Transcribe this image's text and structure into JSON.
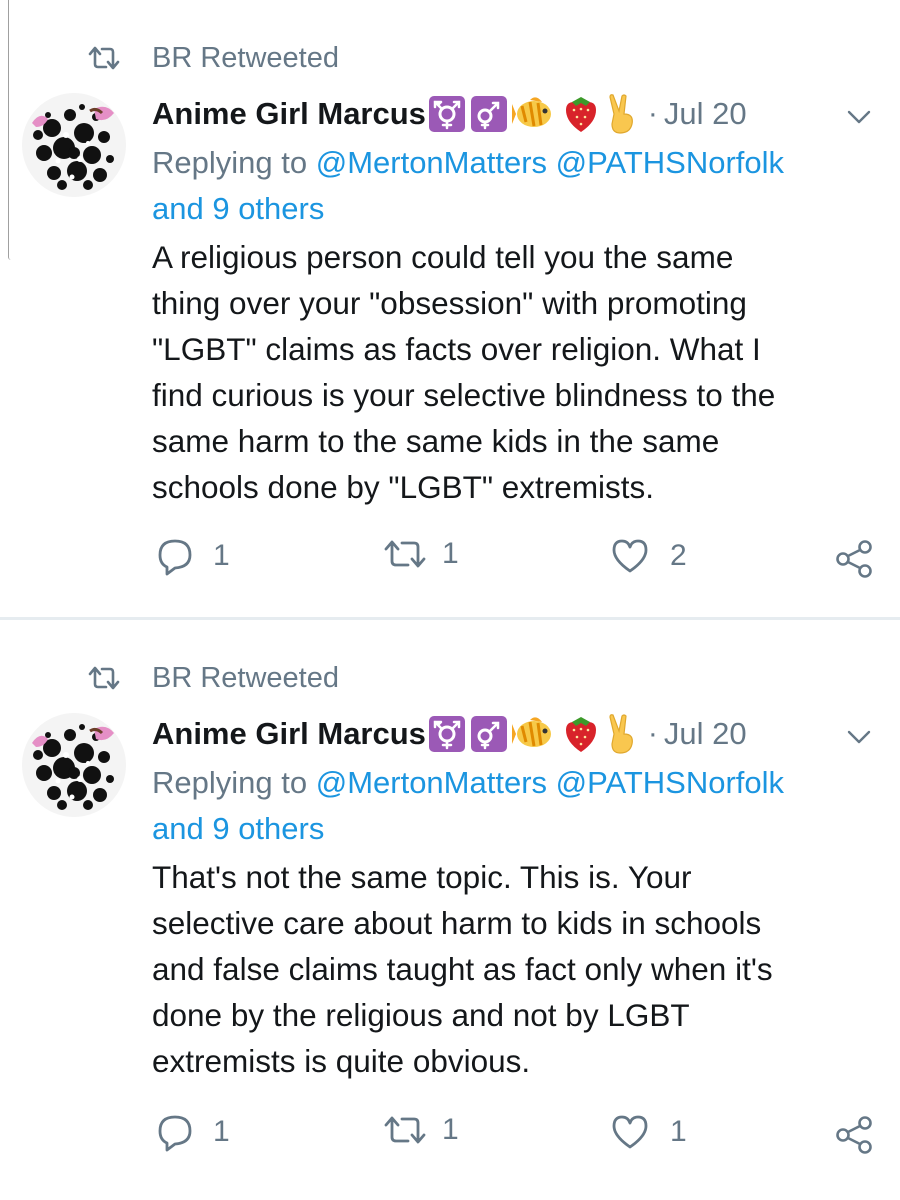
{
  "tweets": [
    {
      "retweet_label": "BR Retweeted",
      "author_name": "Anime Girl Marcus",
      "emoji_icons": [
        "transgender-symbol-icon",
        "male-female-symbol-icon",
        "tropical-fish-icon",
        "strawberry-icon",
        "victory-hand-icon"
      ],
      "separator": "·",
      "date": "Jul 20",
      "replying_prefix": "Replying to ",
      "replying_users": "@MertonMatters @PATHSNorfolk",
      "replying_others": "and 9 others",
      "text": "A religious person could tell you the same\nthing over your \"obsession\" with promoting\n\"LGBT\" claims as facts over religion. What I\nfind curious  is your selective blindness to the\nsame harm to the same kids in the same\nschools done by \"LGBT\" extremists.",
      "reply_count": "1",
      "retweet_count": "1",
      "like_count": "2"
    },
    {
      "retweet_label": "BR Retweeted",
      "author_name": "Anime Girl Marcus",
      "emoji_icons": [
        "transgender-symbol-icon",
        "male-female-symbol-icon",
        "tropical-fish-icon",
        "strawberry-icon",
        "victory-hand-icon"
      ],
      "separator": "·",
      "date": "Jul 20",
      "replying_prefix": "Replying to ",
      "replying_users": "@MertonMatters @PATHSNorfolk",
      "replying_others": "and 9 others",
      "text": "That's not the same topic. This is. Your\nselective care about harm to kids in schools\nand false claims taught as fact only when it's\ndone by the religious and not by LGBT\nextremists is quite obvious.",
      "reply_count": "1",
      "retweet_count": "1",
      "like_count": "1"
    }
  ],
  "colors": {
    "text": "#14171a",
    "secondary": "#657786",
    "link": "#1b95e0",
    "divider": "#e6ecf0",
    "emoji_purple": "#9b59b6"
  }
}
